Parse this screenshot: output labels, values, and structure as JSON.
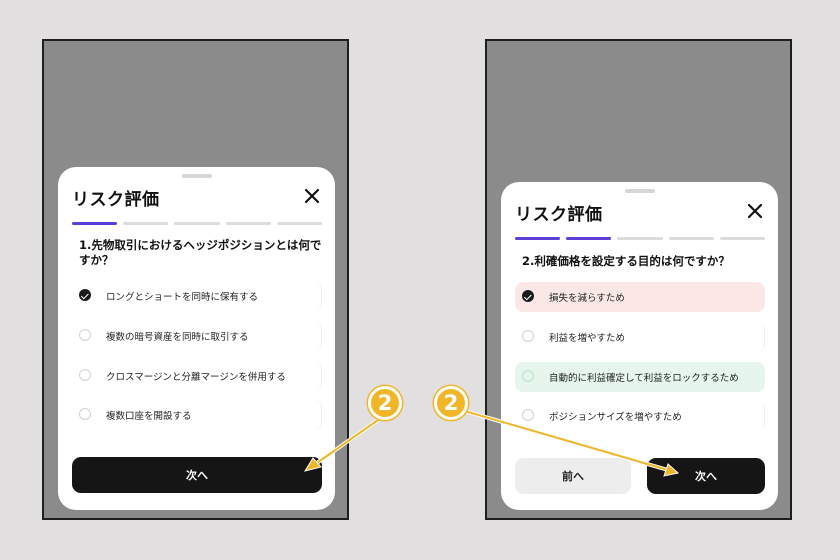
{
  "left_screen": {
    "title": "リスク評価",
    "progress": {
      "total": 5,
      "current": 1
    },
    "question": "1.先物取引におけるヘッジポジションとは何ですか？",
    "options": [
      {
        "label": "ロングとショートを同時に保有する",
        "selected": true
      },
      {
        "label": "複数の暗号資産を同時に取引する",
        "selected": false
      },
      {
        "label": "クロスマージンと分離マージンを併用する",
        "selected": false
      },
      {
        "label": "複数口座を開設する",
        "selected": false
      }
    ],
    "next_label": "次へ"
  },
  "right_screen": {
    "title": "リスク評価",
    "progress": {
      "total": 5,
      "current": 2
    },
    "question": "2.利確価格を設定する目的は何ですか？",
    "options": [
      {
        "label": "損失を減らすため",
        "selected": true,
        "state": "wrong"
      },
      {
        "label": "利益を増やすため",
        "selected": false,
        "state": "none"
      },
      {
        "label": "自動的に利益確定して利益をロックするため",
        "selected": false,
        "state": "correct"
      },
      {
        "label": "ポジションサイズを増やすため",
        "selected": false,
        "state": "none"
      }
    ],
    "prev_label": "前へ",
    "next_label": "次へ"
  },
  "annotations": {
    "step_badge_left": "2",
    "step_badge_right": "2"
  },
  "colors": {
    "backdrop": "#e1dfe0",
    "screen_dim": "#8b8b8b",
    "progress_active": "#5b3fd6",
    "progress_inactive": "#dcdcdc",
    "primary_button": "#151515",
    "wrong_option_bg": "#fbe8e6",
    "correct_option_bg": "#e6f6ec",
    "annotation": "#f0b628"
  },
  "icons": {
    "close": "close-icon",
    "radio_checked": "check-circle-icon"
  }
}
